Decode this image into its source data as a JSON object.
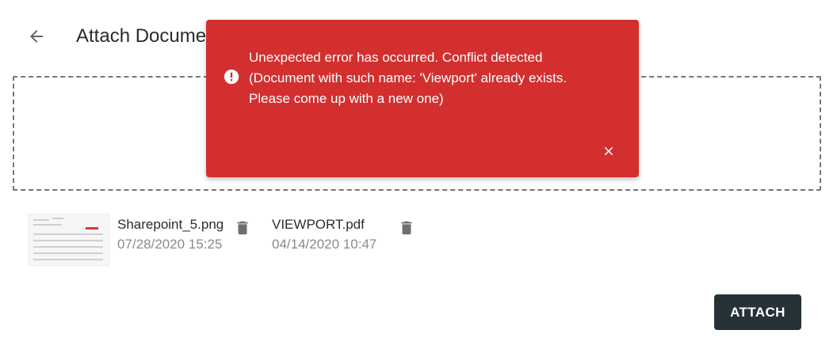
{
  "header": {
    "title": "Attach Document",
    "back_icon": "arrow-left-icon"
  },
  "attachments": [
    {
      "name": "Sharepoint_5.png",
      "date": "07/28/2020 15:25",
      "has_thumbnail": true,
      "delete_icon": "trash-icon"
    },
    {
      "name": "VIEWPORT.pdf",
      "date": "04/14/2020 10:47",
      "has_thumbnail": false,
      "delete_icon": "trash-icon"
    }
  ],
  "actions": {
    "attach_label": "ATTACH"
  },
  "error_toast": {
    "message": "Unexpected error has occurred. Conflict detected\n(Document with such name: 'Viewport' already exists.\nPlease come up with a new one)",
    "icon": "error-icon",
    "close_icon": "close-icon"
  },
  "colors": {
    "toast_background": "#d32f2f",
    "button_background": "#263238",
    "icon_gray": "#6f6f6f"
  }
}
